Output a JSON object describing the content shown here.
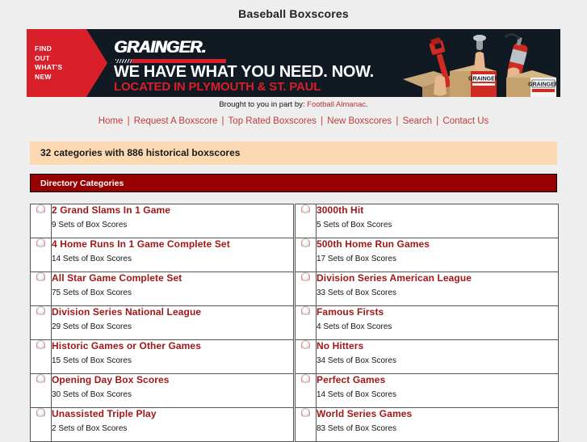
{
  "page": {
    "title": "Baseball Boxscores"
  },
  "banner": {
    "name": "grainger-advertisement-banner",
    "flag_text": "FIND\nOUT\nWHAT'S\nNEW",
    "flag_lines": [
      "FIND",
      "OUT",
      "WHAT'S",
      "NEW"
    ],
    "logo": "GRAINGER.",
    "headline": "WE HAVE WHAT YOU NEED. NOW.",
    "subheadline": "LOCATED IN PLYMOUTH & ST. PAUL",
    "box_label": "GRAINGER",
    "colors": {
      "background": "#111a22",
      "red": "#d81f2a",
      "white": "#ffffff"
    }
  },
  "credit": {
    "prefix": "Brought to you in part by:",
    "link": "Football Almanac",
    "suffix": "."
  },
  "nav": {
    "separator": "|",
    "items": [
      {
        "label": "Home"
      },
      {
        "label": "Request A Boxscore"
      },
      {
        "label": "Top Rated Boxscores"
      },
      {
        "label": "New Boxscores"
      },
      {
        "label": "Search"
      },
      {
        "label": "Contact Us"
      }
    ]
  },
  "summary": {
    "text": "32 categories with 886 historical boxscores",
    "categories_count": 32,
    "boxscores_count": 886
  },
  "directory": {
    "header": "Directory Categories",
    "icon": "baseball-icon",
    "rows": [
      {
        "left": {
          "title": "2 Grand Slams In 1 Game",
          "sets": "9 Sets of Box Scores"
        },
        "right": {
          "title": "3000th Hit",
          "sets": "5 Sets of Box Scores"
        }
      },
      {
        "left": {
          "title": "4 Home Runs In 1 Game Complete Set",
          "sets": "14 Sets of Box Scores"
        },
        "right": {
          "title": "500th Home Run Games",
          "sets": "17 Sets of Box Scores"
        }
      },
      {
        "left": {
          "title": "All Star Game Complete Set",
          "sets": "75 Sets of Box Scores"
        },
        "right": {
          "title": "Division Series American League",
          "sets": "33 Sets of Box Scores"
        }
      },
      {
        "left": {
          "title": "Division Series National League",
          "sets": "29 Sets of Box Scores"
        },
        "right": {
          "title": "Famous Firsts",
          "sets": "4 Sets of Box Scores"
        }
      },
      {
        "left": {
          "title": "Historic Games or Other Games",
          "sets": "15 Sets of Box Scores"
        },
        "right": {
          "title": "No Hitters",
          "sets": "34 Sets of Box Scores"
        }
      },
      {
        "left": {
          "title": "Opening Day Box Scores",
          "sets": "30 Sets of Box Scores"
        },
        "right": {
          "title": "Perfect Games",
          "sets": "14 Sets of Box Scores"
        }
      },
      {
        "left": {
          "title": "Unassisted Triple Play",
          "sets": "2 Sets of Box Scores"
        },
        "right": {
          "title": "World Series Games",
          "sets": "83 Sets of Box Scores"
        }
      }
    ]
  },
  "colors": {
    "page_background": "#eeeeee",
    "summary_bar": "#fcd9b2",
    "header_bar": "#960000",
    "link_red": "#a01818",
    "nav_red": "#c23b3b"
  }
}
